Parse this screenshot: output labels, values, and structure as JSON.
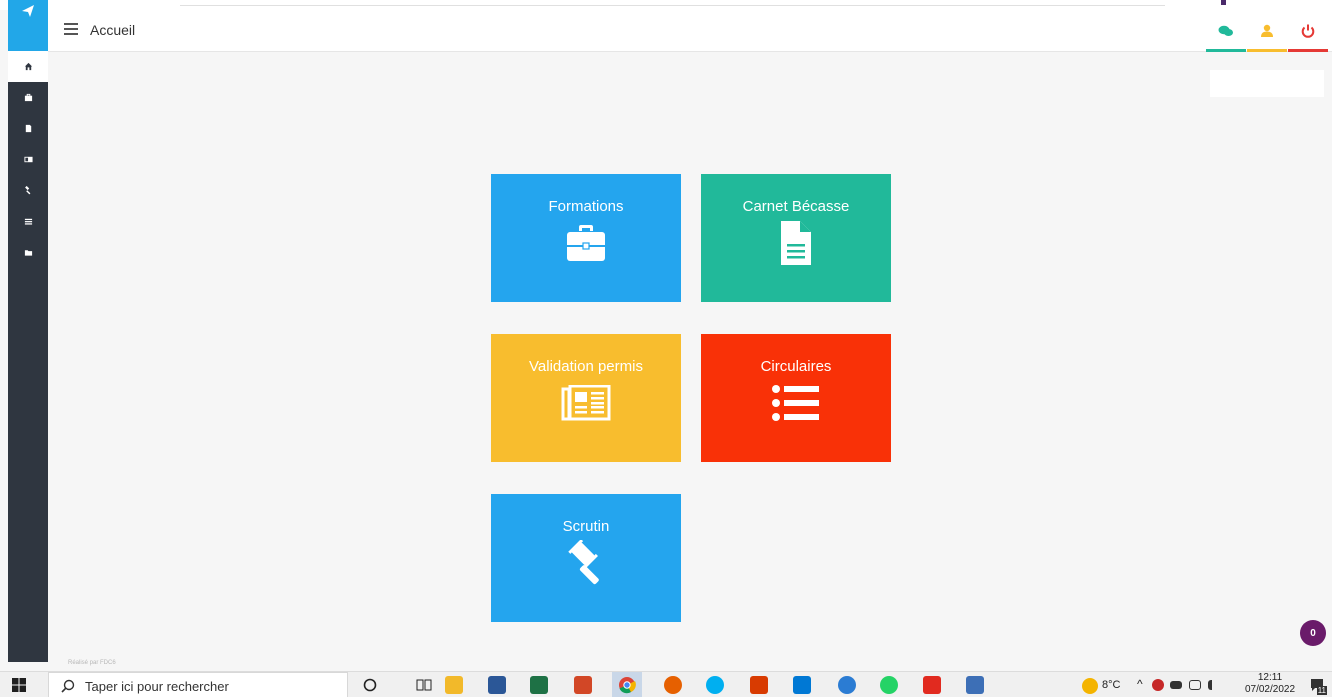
{
  "header": {
    "title": "Accueil"
  },
  "tiles": [
    {
      "label": "Formations",
      "color": "#24a5ee",
      "icon": "briefcase-icon"
    },
    {
      "label": "Carnet Bécasse",
      "color": "#21b99a",
      "icon": "document-icon"
    },
    {
      "label": "Validation permis",
      "color": "#f8bd2e",
      "icon": "newspaper-icon"
    },
    {
      "label": "Circulaires",
      "color": "#f93107",
      "icon": "list-icon"
    },
    {
      "label": "Scrutin",
      "color": "#24a5ee",
      "icon": "gavel-icon"
    }
  ],
  "header_icons": [
    {
      "name": "chat-icon",
      "color": "#21b99a"
    },
    {
      "name": "user-icon",
      "color": "#f8bd2e"
    },
    {
      "name": "power-icon",
      "color": "#e53935"
    }
  ],
  "notification_count": "0",
  "footer_note": "Réalisé par FDC6",
  "taskbar": {
    "search_placeholder": "Taper ici pour rechercher",
    "temperature": "8°C",
    "time": "12:11",
    "date": "07/02/2022",
    "notification_count": "11"
  }
}
